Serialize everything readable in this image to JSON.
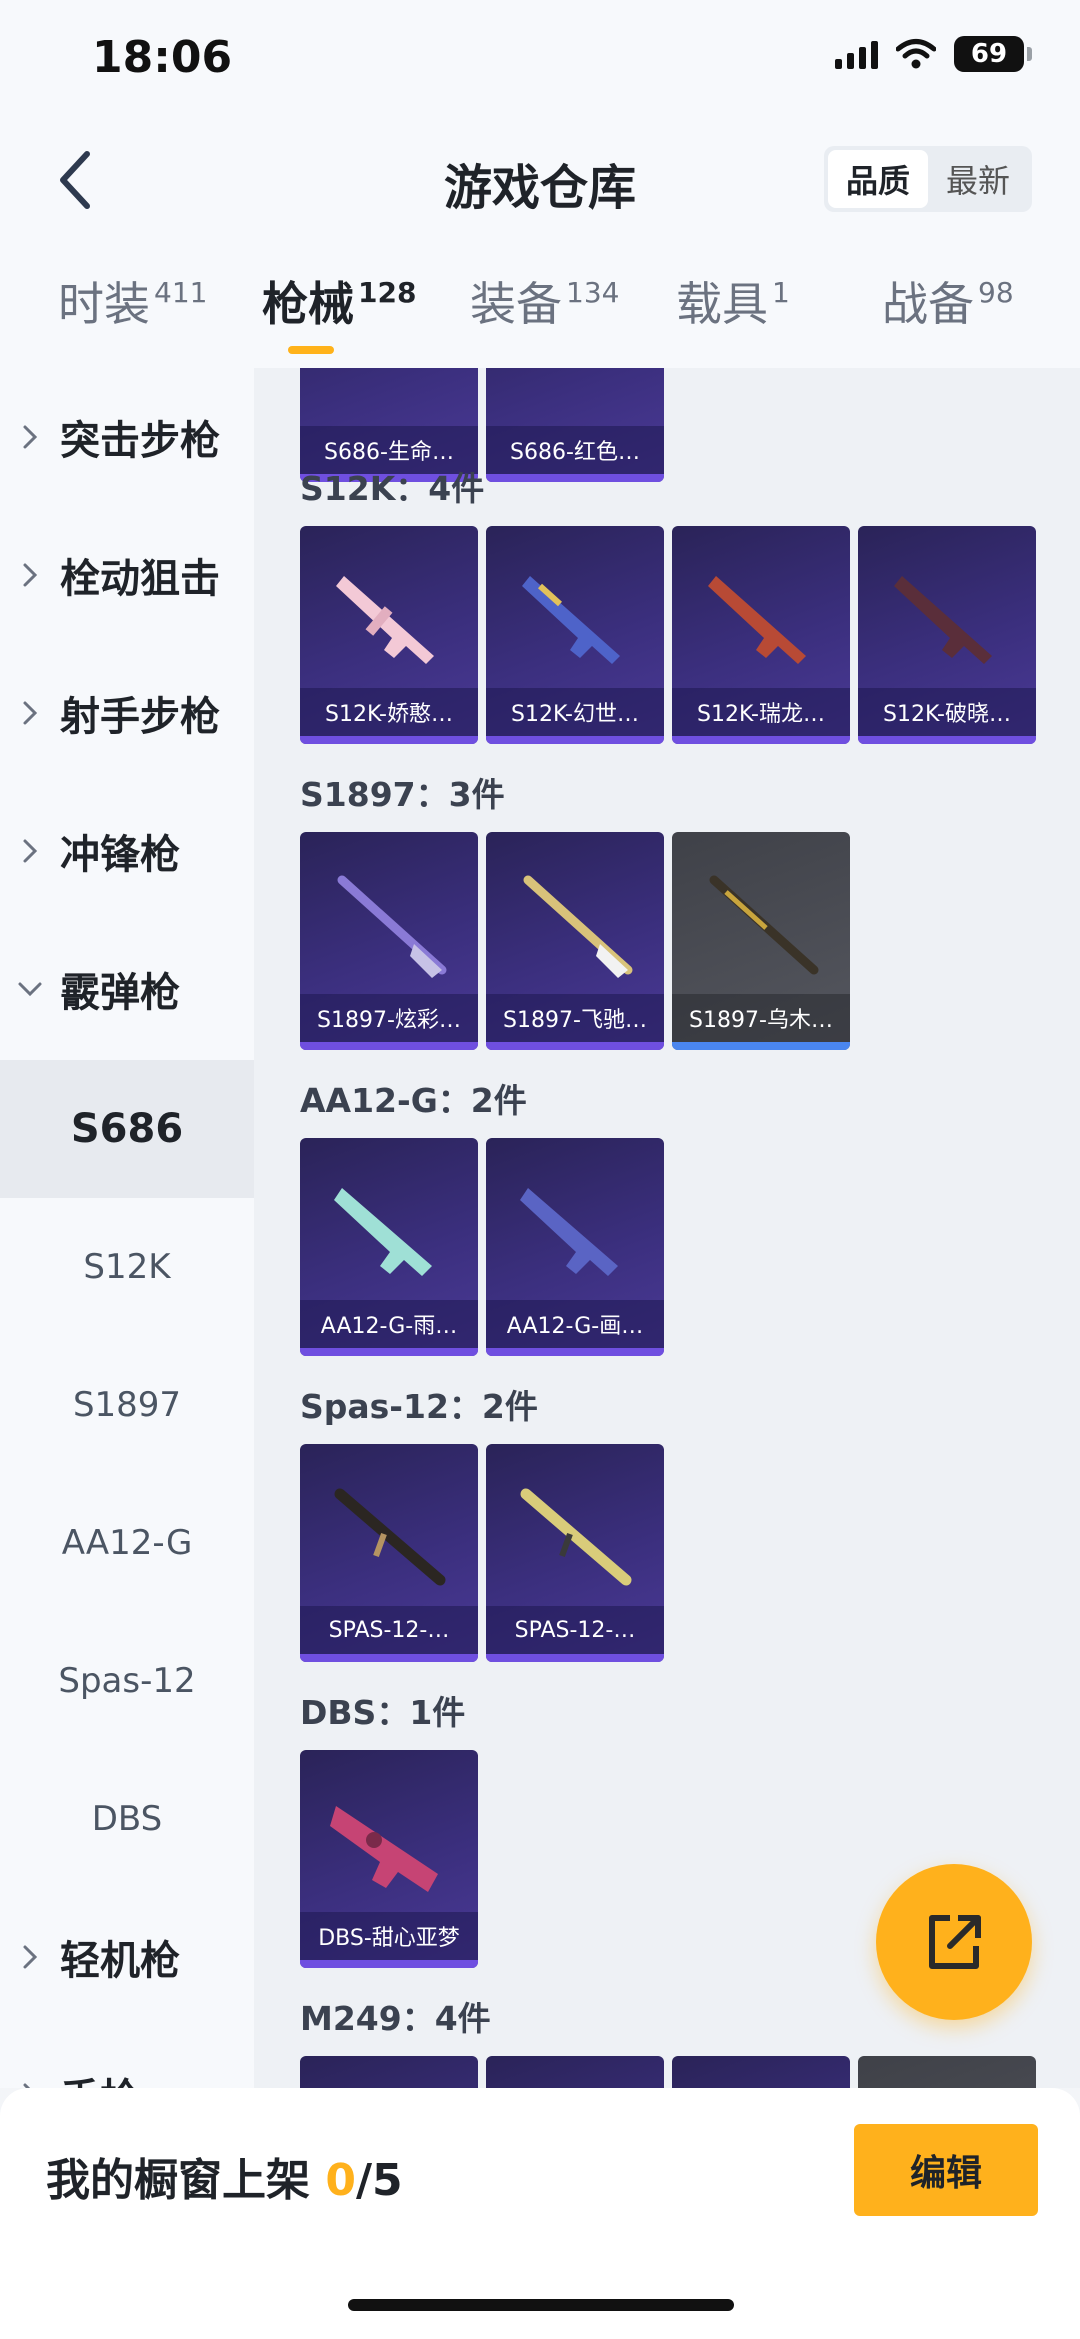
{
  "status_bar": {
    "time": "18:06",
    "battery": "69"
  },
  "header": {
    "title": "游戏仓库",
    "sort_options": [
      "品质",
      "最新"
    ]
  },
  "tabs": [
    {
      "label": "时装",
      "count": "411"
    },
    {
      "label": "枪械",
      "count": "128"
    },
    {
      "label": "装备",
      "count": "134"
    },
    {
      "label": "载具",
      "count": "1"
    },
    {
      "label": "战备",
      "count": "98"
    }
  ],
  "sidebar": {
    "categories": [
      "突击步枪",
      "栓动狙击",
      "射手步枪",
      "冲锋枪",
      "霰弹枪",
      "轻机枪",
      "手枪"
    ],
    "subs": [
      "S686",
      "S12K",
      "S1897",
      "AA12-G",
      "Spas-12",
      "DBS"
    ]
  },
  "groups": {
    "s686": {
      "items": [
        "S686-生命…",
        "S686-红色…"
      ]
    },
    "s12k": {
      "title": "S12K：4件",
      "items": [
        "S12K-娇憨…",
        "S12K-幻世…",
        "S12K-瑞龙…",
        "S12K-破晓…"
      ]
    },
    "s1897": {
      "title": "S1897：3件",
      "items": [
        "S1897-炫彩…",
        "S1897-飞驰…",
        "S1897-乌木…"
      ]
    },
    "aa12g": {
      "title": "AA12-G：2件",
      "items": [
        "AA12-G-雨…",
        "AA12-G-画…"
      ]
    },
    "spas12": {
      "title": "Spas-12：2件",
      "items": [
        "SPAS-12-…",
        "SPAS-12-…"
      ]
    },
    "dbs": {
      "title": "DBS：1件",
      "items": [
        "DBS-甜心亚梦"
      ]
    },
    "m249": {
      "title": "M249：4件"
    }
  },
  "bottom": {
    "label": "我的橱窗上架 ",
    "count": "0",
    "total": "/5",
    "edit": "编辑"
  },
  "colors": {
    "accent": "#ffb11c",
    "card_purple": "#3b2f7e",
    "card_gray": "#55575f"
  }
}
